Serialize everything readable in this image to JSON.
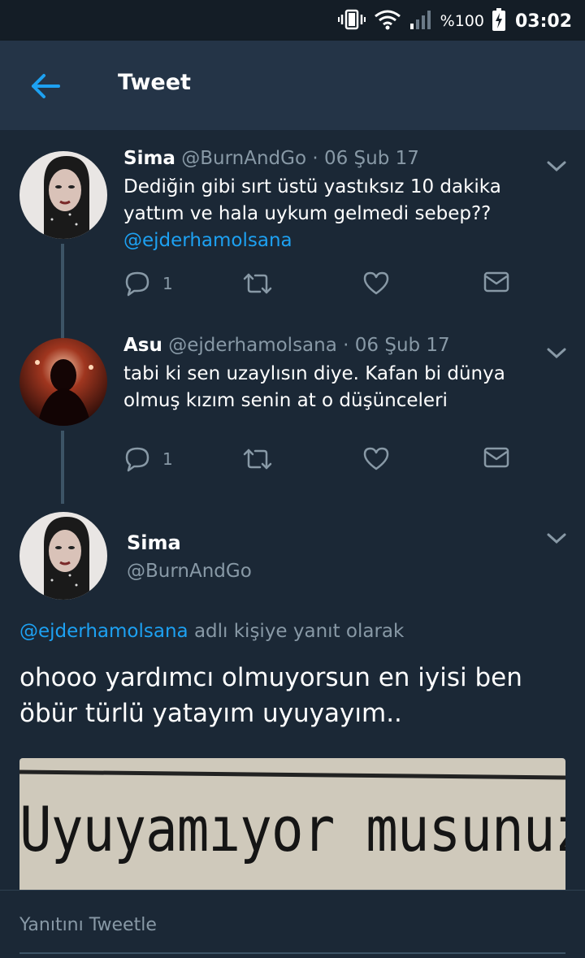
{
  "status_bar": {
    "battery_text": "%100",
    "time": "03:02"
  },
  "app_bar": {
    "title": "Tweet"
  },
  "thread": [
    {
      "name": "Sima",
      "handle": "@BurnAndGo",
      "date": "· 06 Şub 17",
      "text": "Dediğin gibi sırt üstü yastıksız 10 dakika yattım ve hala uykum gelmedi sebep??",
      "mention": "@ejderhamolsana",
      "reply_count": "1"
    },
    {
      "name": "Asu",
      "handle": "@ejderhamolsana",
      "date": "· 06 Şub 17",
      "text": "tabi ki sen uzaylısın diye. Kafan bi dünya olmuş kızım senin at o düşünceleri",
      "reply_count": "1"
    }
  ],
  "focused_tweet": {
    "name": "Sima",
    "handle": "@BurnAndGo",
    "reply_to_mention": "@ejderhamolsana",
    "reply_to_suffix": " adlı kişiye yanıt olarak",
    "text": "ohooo yardımcı olmuyorsun en iyisi ben öbür türlü yatayım uyuyayım..",
    "media_text": "Uyuyamıyor  musunuz"
  },
  "compose": {
    "placeholder": "Yanıtını Tweetle"
  },
  "colors": {
    "background": "#1b2836",
    "app_bar": "#243447",
    "accent": "#1da1f2",
    "secondary_text": "#8899a6"
  }
}
